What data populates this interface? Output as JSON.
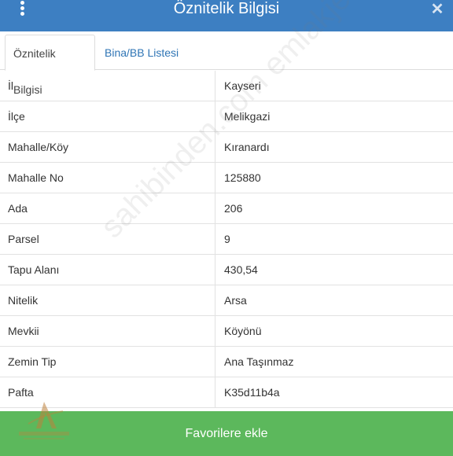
{
  "header": {
    "title": "Öznitelik Bilgisi",
    "menu_icon": "vertical-dots-icon",
    "close_icon": "close-icon",
    "background_color": "#3d7fc2"
  },
  "tabs": [
    {
      "label": "Öznitelik Bilgisi",
      "active": true
    },
    {
      "label": "Bina/BB Listesi",
      "active": false
    }
  ],
  "attributes": [
    {
      "key": "İl",
      "value": "Kayseri"
    },
    {
      "key": "İlçe",
      "value": "Melikgazi"
    },
    {
      "key": "Mahalle/Köy",
      "value": "Kıranardı"
    },
    {
      "key": "Mahalle No",
      "value": "125880"
    },
    {
      "key": "Ada",
      "value": "206"
    },
    {
      "key": "Parsel",
      "value": "9"
    },
    {
      "key": "Tapu Alanı",
      "value": "430,54"
    },
    {
      "key": "Nitelik",
      "value": "Arsa"
    },
    {
      "key": "Mevkii",
      "value": "Köyönü"
    },
    {
      "key": "Zemin Tip",
      "value": "Ana Taşınmaz"
    },
    {
      "key": "Pafta",
      "value": "K35d11b4a"
    }
  ],
  "watermark": {
    "text": "sahibinden.com emlakjet.com"
  },
  "footer": {
    "button_label": "Favorilere ekle",
    "button_color": "#5cb85c"
  }
}
